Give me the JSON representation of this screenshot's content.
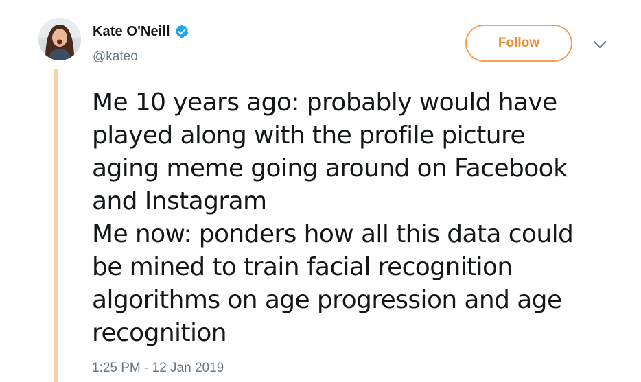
{
  "user": {
    "display_name": "Kate O'Neill",
    "handle": "@kateo",
    "verified": true
  },
  "actions": {
    "follow_label": "Follow"
  },
  "tweet": {
    "lines": [
      "Me 10 years ago: probably would have",
      "played along with the profile picture",
      "aging meme going around on Facebook",
      "and Instagram",
      "Me now: ponders how all this data could",
      "be mined to train facial recognition",
      "algorithms on age progression and age",
      "recognition"
    ],
    "timestamp": "1:25 PM - 12 Jan 2019"
  },
  "icons": {
    "verified": "verified-badge-icon",
    "more": "chevron-down-icon"
  },
  "colors": {
    "accent": "#f28a2e",
    "thread_line": "#fbd1ab",
    "verified_blue": "#1da1f2",
    "muted_text": "#657786"
  }
}
